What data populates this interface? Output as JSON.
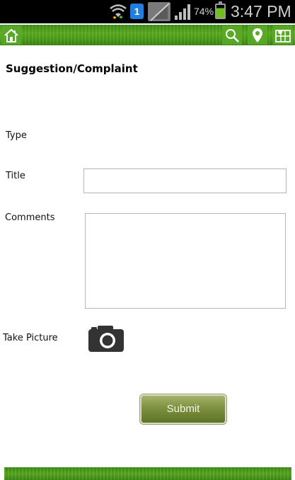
{
  "status_bar": {
    "notification_badge": "1",
    "battery_percent": "74%",
    "time": "3:47 PM",
    "icons": [
      "wifi-icon",
      "notification-icon",
      "no-sim-icon",
      "signal-icon",
      "battery-icon"
    ]
  },
  "header": {
    "buttons": [
      "home-icon",
      "search-icon",
      "location-pin-icon",
      "map-icon"
    ],
    "accent_color": "#4d9d1a"
  },
  "form": {
    "title": "Suggestion/Complaint",
    "type_label": "Type",
    "title_label": "Title",
    "title_value": "",
    "comments_label": "Comments",
    "comments_value": "",
    "picture_label": "Take Picture",
    "picture_icon": "camera-icon",
    "submit_label": "Submit",
    "submit_color": "#7e9140"
  }
}
